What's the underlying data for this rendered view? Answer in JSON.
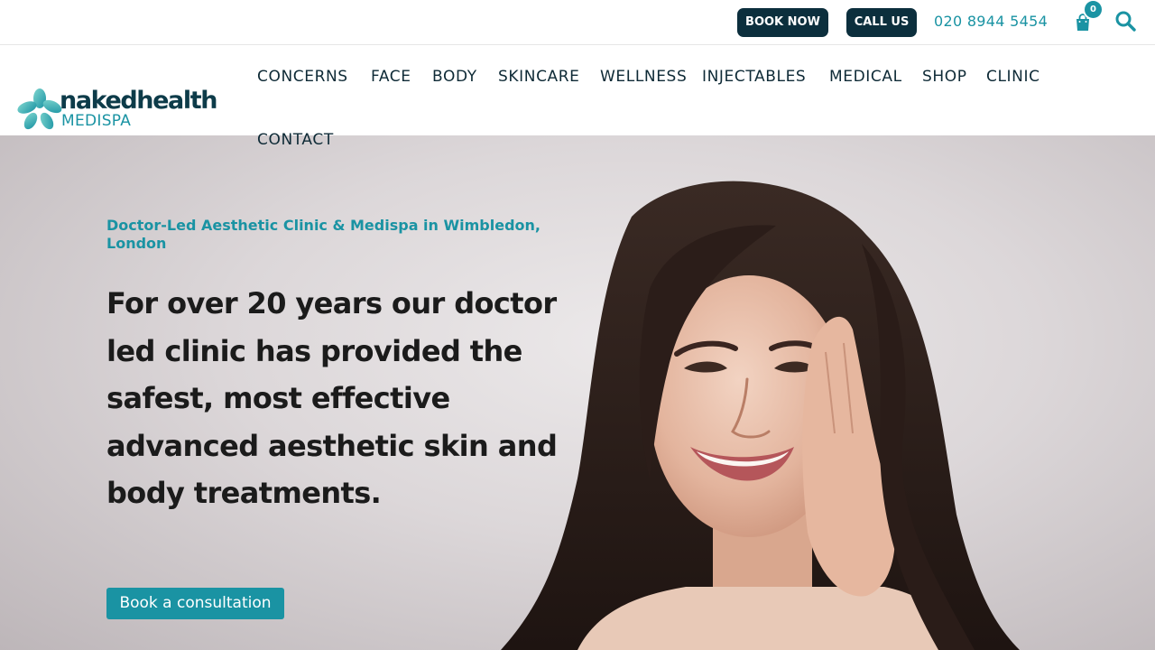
{
  "topbar": {
    "book_now_label": "BOOK NOW",
    "call_us_label": "CALL US",
    "phone": "020 8944 5454",
    "cart_count": "0",
    "cart_icon": "shopping-bag-icon",
    "search_icon": "search-icon"
  },
  "logo": {
    "word": "nakedhealth",
    "sub": "MEDISPA",
    "icon": "flower-icon"
  },
  "nav": {
    "items": [
      {
        "label": "CONCERNS"
      },
      {
        "label": "FACE"
      },
      {
        "label": "BODY"
      },
      {
        "label": "SKINCARE"
      },
      {
        "label": "WELLNESS"
      },
      {
        "label": "INJECTABLES"
      },
      {
        "label": "MEDICAL"
      },
      {
        "label": "SHOP"
      },
      {
        "label": "CLINIC"
      },
      {
        "label": "CONTACT"
      }
    ]
  },
  "hero": {
    "eyebrow": "Doctor-Led Aesthetic Clinic & Medispa in Wimbledon, London",
    "headline": "For over 20 years our doctor led clinic has provided the safest, most effective advanced aesthetic skin and body treatments.",
    "cta_label": "Book a consultation"
  },
  "colors": {
    "accent": "#1a93a3",
    "dark": "#0c2f3d",
    "text": "#1b1b1b"
  }
}
